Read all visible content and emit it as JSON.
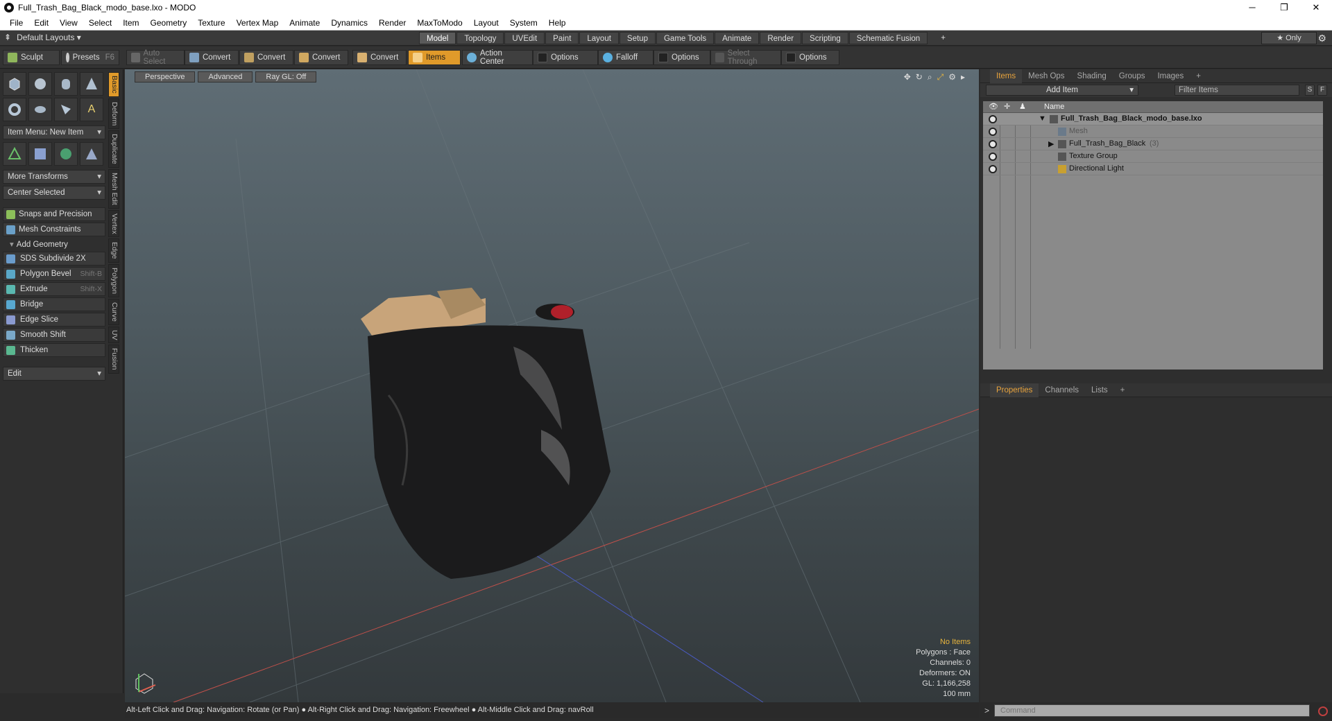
{
  "window": {
    "title": "Full_Trash_Bag_Black_modo_base.lxo - MODO",
    "minimize": "─",
    "maximize": "❐",
    "close": "✕"
  },
  "menu": [
    "File",
    "Edit",
    "View",
    "Select",
    "Item",
    "Geometry",
    "Texture",
    "Vertex Map",
    "Animate",
    "Dynamics",
    "Render",
    "MaxToModo",
    "Layout",
    "System",
    "Help"
  ],
  "layouts": {
    "label": "Default Layouts ▾"
  },
  "mode_tabs": [
    "Model",
    "Topology",
    "UVEdit",
    "Paint",
    "Layout",
    "Setup",
    "Game Tools",
    "Animate",
    "Render",
    "Scripting",
    "Schematic Fusion"
  ],
  "mode_add": "+",
  "only": "★  Only",
  "toolbar": {
    "sculpt": "Sculpt",
    "presets": "Presets",
    "presets_key": "F6",
    "auto_select": "Auto Select",
    "convert": "Convert",
    "items": "Items",
    "action_center": "Action Center",
    "options": "Options",
    "falloff": "Falloff",
    "select_through": "Select Through"
  },
  "left_panel": {
    "item_menu": "Item Menu: New Item",
    "more_transforms": "More Transforms",
    "center_selected": "Center Selected",
    "snaps": "Snaps and Precision",
    "mesh_constraints": "Mesh Constraints",
    "add_geometry": "Add Geometry",
    "tools": [
      {
        "label": "SDS Subdivide 2X",
        "key": ""
      },
      {
        "label": "Polygon Bevel",
        "key": "Shift-B"
      },
      {
        "label": "Extrude",
        "key": "Shift-X"
      },
      {
        "label": "Bridge",
        "key": ""
      },
      {
        "label": "Edge Slice",
        "key": ""
      },
      {
        "label": "Smooth Shift",
        "key": ""
      },
      {
        "label": "Thicken",
        "key": ""
      }
    ],
    "edit": "Edit",
    "vtabs": [
      "Basic",
      "Deform",
      "Duplicate",
      "Mesh Edit",
      "Vertex",
      "Edge",
      "Polygon",
      "Curve",
      "UV",
      "Fusion"
    ]
  },
  "viewport": {
    "perspective": "Perspective",
    "advanced": "Advanced",
    "raygl": "Ray GL: Off",
    "stats": {
      "no_items": "No Items",
      "polygons": "Polygons : Face",
      "channels": "Channels: 0",
      "deformers": "Deformers: ON",
      "gl": "GL: 1,166,258",
      "scale": "100 mm"
    }
  },
  "right_panel": {
    "tabs": [
      "Items",
      "Mesh Ops",
      "Shading",
      "Groups",
      "Images"
    ],
    "add": "+",
    "add_item": "Add Item",
    "filter": "Filter Items",
    "s": "S",
    "f": "F",
    "name_col": "Name",
    "tree": [
      {
        "label": "Full_Trash_Bag_Black_modo_base.lxo",
        "indent": 0,
        "bold": true,
        "arrow": "▼"
      },
      {
        "label": "Mesh",
        "indent": 1,
        "bold": false,
        "arrow": ""
      },
      {
        "label": "Full_Trash_Bag_Black",
        "count": "(3)",
        "indent": 1,
        "bold": false,
        "arrow": "▶"
      },
      {
        "label": "Texture Group",
        "indent": 1,
        "bold": false,
        "arrow": ""
      },
      {
        "label": "Directional Light",
        "indent": 1,
        "bold": false,
        "arrow": ""
      }
    ],
    "prop_tabs": [
      "Properties",
      "Channels",
      "Lists"
    ]
  },
  "status": "Alt-Left Click and Drag: Navigation: Rotate (or Pan) ● Alt-Right Click and Drag: Navigation: Freewheel ● Alt-Middle Click and Drag: navRoll",
  "command": {
    "prompt": ">",
    "placeholder": "Command"
  }
}
